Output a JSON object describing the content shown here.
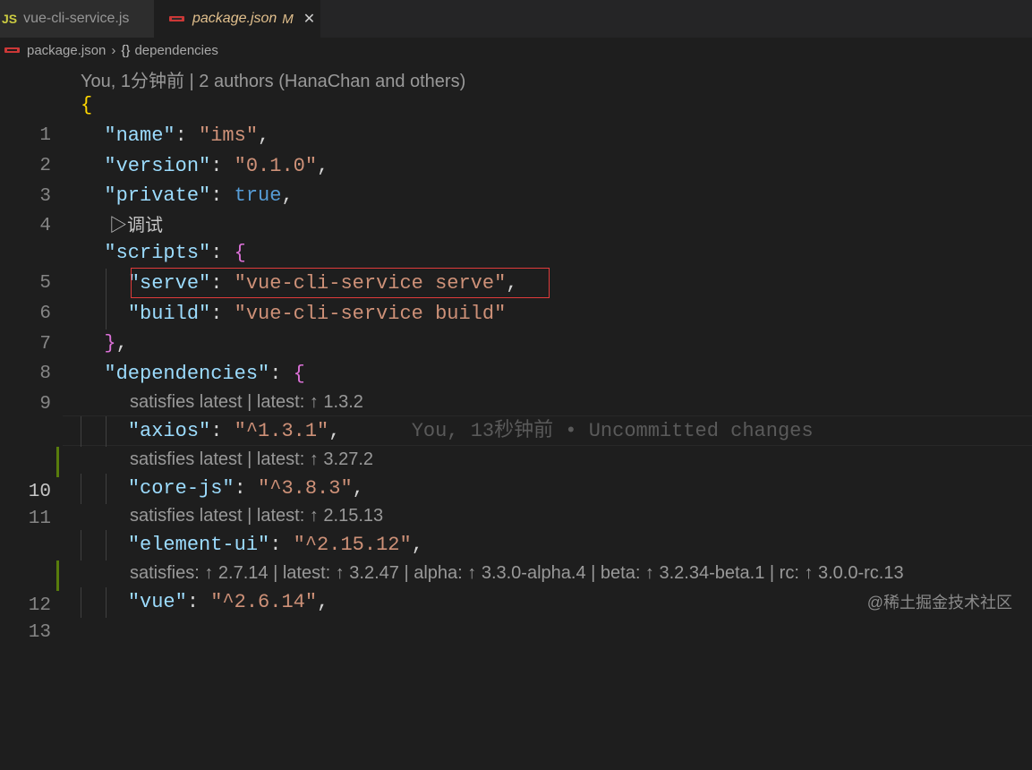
{
  "tabs": [
    {
      "icon": "JS",
      "label": "vue-cli-service.js"
    },
    {
      "label": "package.json",
      "status": "M",
      "close": "✕"
    }
  ],
  "breadcrumb": {
    "file": "package.json",
    "separator": "›",
    "symbol_icon": "{}",
    "symbol": "dependencies"
  },
  "blame_header": "You, 1分钟前 | 2 authors (HanaChan and others)",
  "debug_lens": {
    "icon": "▷",
    "label": "调试"
  },
  "lines": {
    "n1": "1",
    "n2": "2",
    "n3": "3",
    "n4": "4",
    "n5": "5",
    "n6": "6",
    "n7": "7",
    "n8": "8",
    "n9": "9",
    "n10": "10",
    "n11": "11",
    "n12": "12",
    "n13": "13"
  },
  "code": {
    "name_key": "\"name\"",
    "name_val": "\"ims\"",
    "version_key": "\"version\"",
    "version_val": "\"0.1.0\"",
    "private_key": "\"private\"",
    "private_val": "true",
    "scripts_key": "\"scripts\"",
    "serve_key": "\"serve\"",
    "serve_val": "\"vue-cli-service serve\"",
    "build_key": "\"build\"",
    "build_val": "\"vue-cli-service build\"",
    "deps_key": "\"dependencies\"",
    "axios_key": "\"axios\"",
    "axios_val": "\"^1.3.1\"",
    "corejs_key": "\"core-js\"",
    "corejs_val": "\"^3.8.3\"",
    "element_key": "\"element-ui\"",
    "element_val": "\"^2.15.12\"",
    "vue_key": "\"vue\"",
    "vue_val": "\"^2.6.14\""
  },
  "inline_blame": "You, 13秒钟前 • Uncommitted changes",
  "version_lens": {
    "axios": "satisfies latest | latest: ↑ 1.3.2",
    "corejs": "satisfies latest | latest: ↑ 3.27.2",
    "element": "satisfies latest | latest: ↑ 2.15.13",
    "vue": "satisfies: ↑ 2.7.14 | latest: ↑ 3.2.47 | alpha: ↑ 3.3.0-alpha.4 | beta: ↑ 3.2.34-beta.1 | rc: ↑ 3.0.0-rc.13"
  },
  "watermark": "@稀土掘金技术社区"
}
